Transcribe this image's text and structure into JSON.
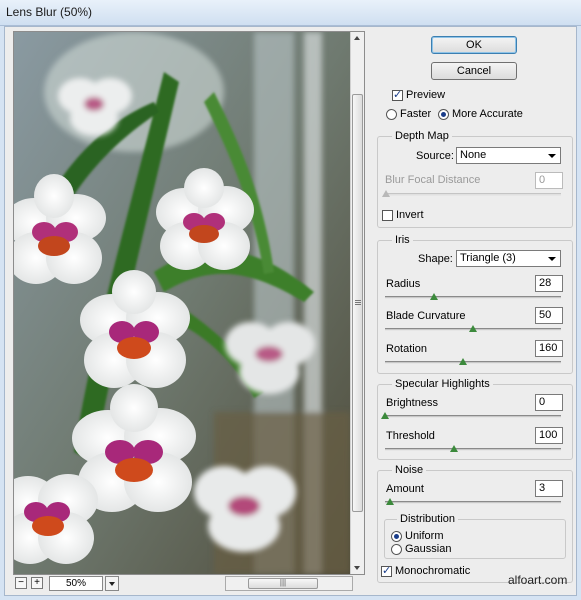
{
  "window": {
    "title": "Lens Blur (50%)"
  },
  "buttons": {
    "ok": "OK",
    "cancel": "Cancel"
  },
  "preview": {
    "label": "Preview",
    "checked": true,
    "faster_label": "Faster",
    "more_accurate_label": "More Accurate",
    "selected": "More Accurate"
  },
  "depth_map": {
    "title": "Depth Map",
    "source_label": "Source:",
    "source_value": "None",
    "blur_focal_distance_label": "Blur Focal Distance",
    "blur_focal_distance_value": "0",
    "invert_label": "Invert",
    "invert_checked": false
  },
  "iris": {
    "title": "Iris",
    "shape_label": "Shape:",
    "shape_value": "Triangle (3)",
    "radius_label": "Radius",
    "radius_value": "28",
    "radius_max": 100,
    "blade_curvature_label": "Blade Curvature",
    "blade_curvature_value": "50",
    "blade_curvature_max": 100,
    "rotation_label": "Rotation",
    "rotation_value": "160",
    "rotation_max": 360
  },
  "specular": {
    "title": "Specular Highlights",
    "brightness_label": "Brightness",
    "brightness_value": "0",
    "brightness_max": 100,
    "threshold_label": "Threshold",
    "threshold_value": "100",
    "threshold_max": 255
  },
  "noise": {
    "title": "Noise",
    "amount_label": "Amount",
    "amount_value": "3",
    "amount_max": 100,
    "distribution_title": "Distribution",
    "uniform_label": "Uniform",
    "gaussian_label": "Gaussian",
    "distribution_selected": "Uniform",
    "monochromatic_label": "Monochromatic",
    "monochromatic_checked": true
  },
  "zoom": {
    "value": "50%",
    "minus": "−",
    "plus": "+"
  },
  "watermark": "alfoart.com",
  "colors": {
    "accent": "#3c7fb1",
    "slider_thumb": "#3c8a3c",
    "orchid_pink": "#b0307a"
  }
}
